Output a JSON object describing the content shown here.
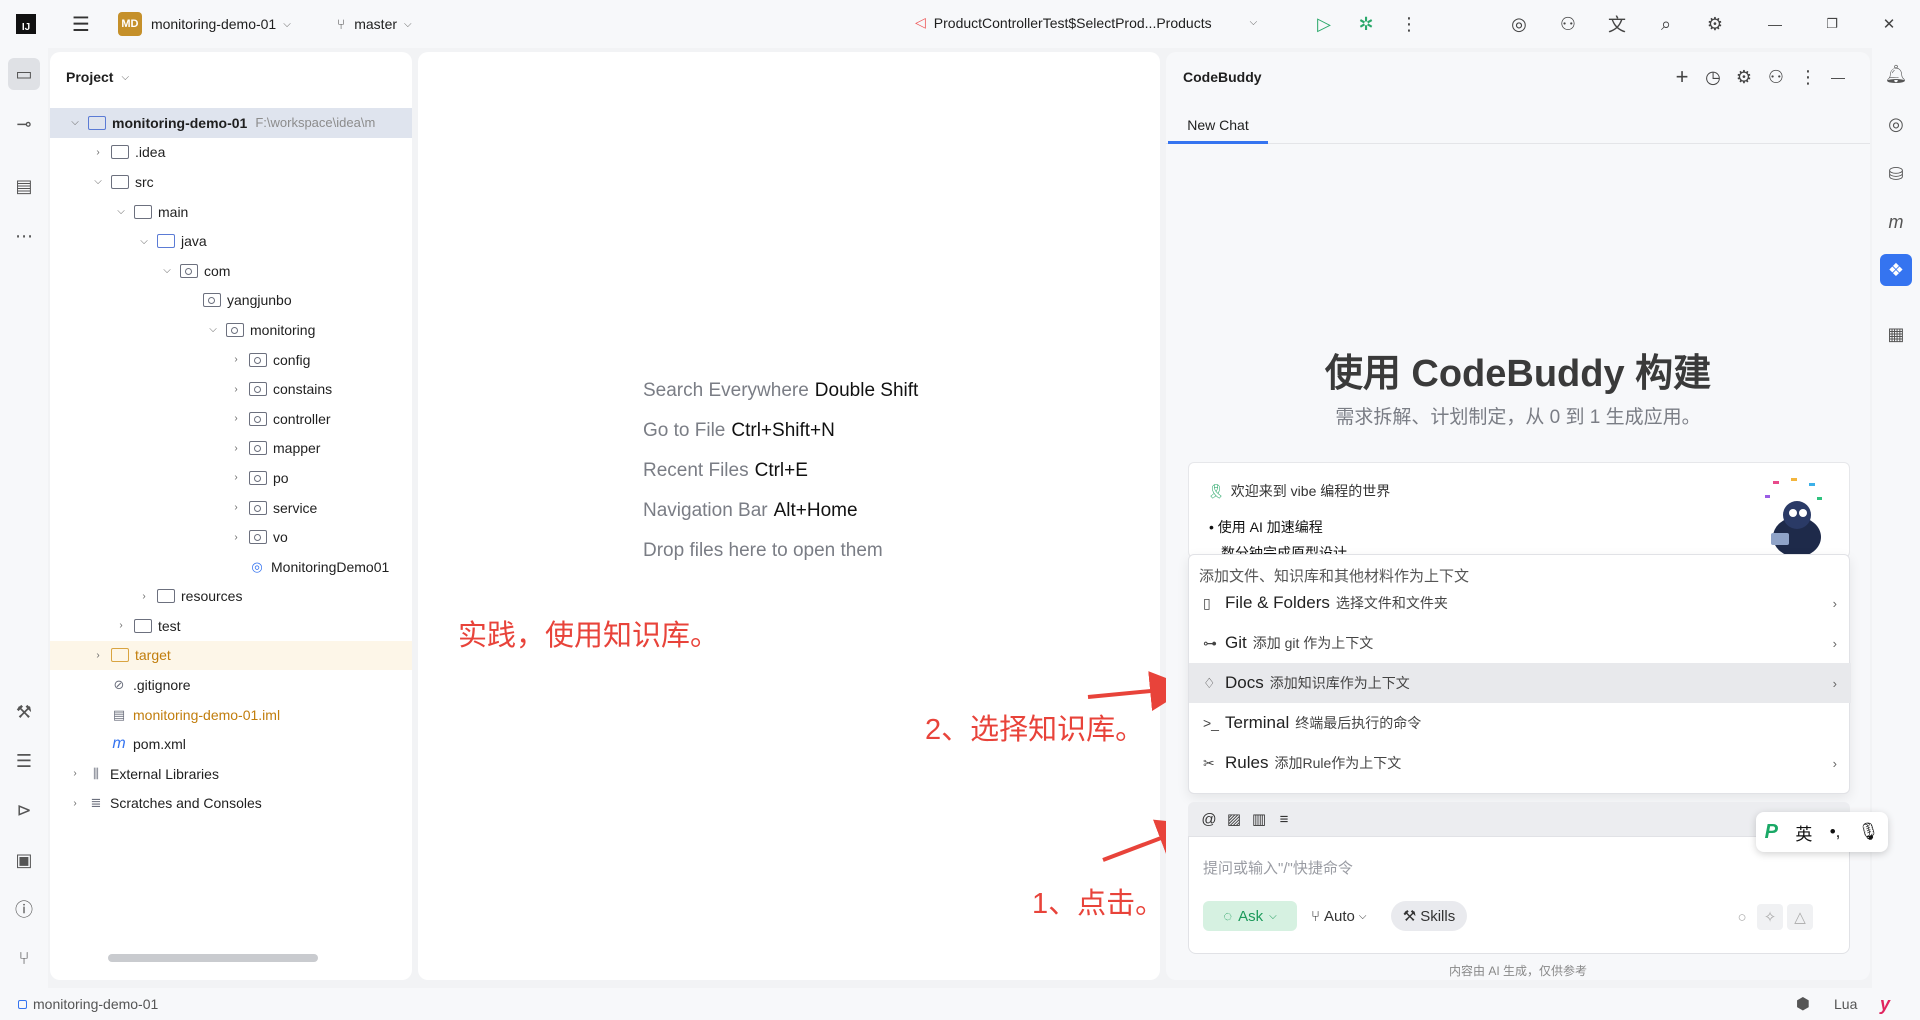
{
  "titlebar": {
    "app_icon": "IJ",
    "project_badge": "MD",
    "project_name": "monitoring-demo-01",
    "branch": "master",
    "run_config": "ProductControllerTest$SelectProd...Products"
  },
  "left_strip": {
    "icons": [
      "folder-icon",
      "commit-icon",
      "structure-icon",
      "more-icon",
      "build-icon",
      "services-icon",
      "run-icon",
      "terminal-icon",
      "problems-icon",
      "git-icon"
    ]
  },
  "project_panel": {
    "header": "Project",
    "tree": [
      {
        "label": "monitoring-demo-01",
        "sub": "F:\\workspace\\idea\\m",
        "depth": 0,
        "arrow": "down",
        "icon": "module",
        "bold": true
      },
      {
        "label": ".idea",
        "depth": 1,
        "arrow": "right",
        "icon": "folder"
      },
      {
        "label": "src",
        "depth": 1,
        "arrow": "down",
        "icon": "folder"
      },
      {
        "label": "main",
        "depth": 2,
        "arrow": "down",
        "icon": "folder"
      },
      {
        "label": "java",
        "depth": 3,
        "arrow": "down",
        "icon": "folder-blue"
      },
      {
        "label": "com",
        "depth": 4,
        "arrow": "down",
        "icon": "package"
      },
      {
        "label": "yangjunbo",
        "depth": 5,
        "arrow": "",
        "icon": "package"
      },
      {
        "label": "monitoring",
        "depth": 6,
        "arrow": "down",
        "icon": "package"
      },
      {
        "label": "config",
        "depth": 7,
        "arrow": "right",
        "icon": "package"
      },
      {
        "label": "constains",
        "depth": 7,
        "arrow": "right",
        "icon": "package"
      },
      {
        "label": "controller",
        "depth": 7,
        "arrow": "right",
        "icon": "package"
      },
      {
        "label": "mapper",
        "depth": 7,
        "arrow": "right",
        "icon": "package"
      },
      {
        "label": "po",
        "depth": 7,
        "arrow": "right",
        "icon": "package"
      },
      {
        "label": "service",
        "depth": 7,
        "arrow": "right",
        "icon": "package"
      },
      {
        "label": "vo",
        "depth": 7,
        "arrow": "right",
        "icon": "package"
      },
      {
        "label": "MonitoringDemo01",
        "depth": 7,
        "arrow": "",
        "icon": "spring-class"
      },
      {
        "label": "resources",
        "depth": 3,
        "arrow": "right",
        "icon": "folder"
      },
      {
        "label": "test",
        "depth": 2,
        "arrow": "right",
        "icon": "folder"
      },
      {
        "label": "target",
        "depth": 1,
        "arrow": "right",
        "icon": "folder-orange",
        "orange": true
      },
      {
        "label": ".gitignore",
        "depth": 1,
        "arrow": "",
        "icon": "ignore"
      },
      {
        "label": "monitoring-demo-01.iml",
        "depth": 1,
        "arrow": "",
        "icon": "iml",
        "orange": true
      },
      {
        "label": "pom.xml",
        "depth": 1,
        "arrow": "",
        "icon": "maven"
      },
      {
        "label": "External Libraries",
        "depth": 0,
        "arrow": "right",
        "icon": "library"
      },
      {
        "label": "Scratches and Consoles",
        "depth": 0,
        "arrow": "right",
        "icon": "scratch"
      }
    ]
  },
  "editor": {
    "hints": [
      {
        "text": "Search Everywhere",
        "key": "Double Shift"
      },
      {
        "text": "Go to File",
        "key": "Ctrl+Shift+N"
      },
      {
        "text": "Recent Files",
        "key": "Ctrl+E"
      },
      {
        "text": "Navigation Bar",
        "key": "Alt+Home"
      },
      {
        "text": "Drop files here to open them",
        "key": ""
      }
    ]
  },
  "annotations": {
    "practice": "实践，使用知识库。",
    "step2": "2、选择知识库。",
    "step1": "1、点击。",
    "arrow_color": "#e8433a"
  },
  "codebuddy": {
    "title": "CodeBuddy",
    "tab": "New Chat",
    "headline": "使用 CodeBuddy 构建",
    "subtitle": "需求拆解、计划制定，从 0 到 1 生成应用。",
    "welcome": {
      "title": "欢迎来到 vibe 编程的世界",
      "item1": "使用 AI 加速编程",
      "item2": "数分钟完成原型设计"
    },
    "context_menu": {
      "placeholder": "添加文件、知识库和其他材料作为上下文",
      "items": [
        {
          "label": "File & Folders",
          "desc": "选择文件和文件夹",
          "icon": "file-icon",
          "chevron": true
        },
        {
          "label": "Git",
          "desc": "添加 git 作为上下文",
          "icon": "git-icon",
          "chevron": true
        },
        {
          "label": "Docs",
          "desc": "添加知识库作为上下文",
          "icon": "bulb-icon",
          "chevron": true,
          "highlight": true
        },
        {
          "label": "Terminal",
          "desc": "终端最后执行的命令",
          "icon": "terminal-icon",
          "chevron": false
        },
        {
          "label": "Rules",
          "desc": "添加Rule作为上下文",
          "icon": "rules-icon",
          "chevron": true
        }
      ]
    },
    "input_placeholder": "提问或输入\"/\"快捷命令",
    "ask_label": "Ask",
    "auto_label": "Auto",
    "skills_label": "Skills",
    "footnote": "内容由 AI 生成，仅供参考",
    "accent": "#1c9a5a"
  },
  "ime": {
    "mode": "英",
    "punct": "•,"
  },
  "statusbar": {
    "project": "monitoring-demo-01",
    "language": "Lua"
  },
  "colors": {
    "accent_blue": "#3574f0",
    "annotation_red": "#e8433a"
  }
}
